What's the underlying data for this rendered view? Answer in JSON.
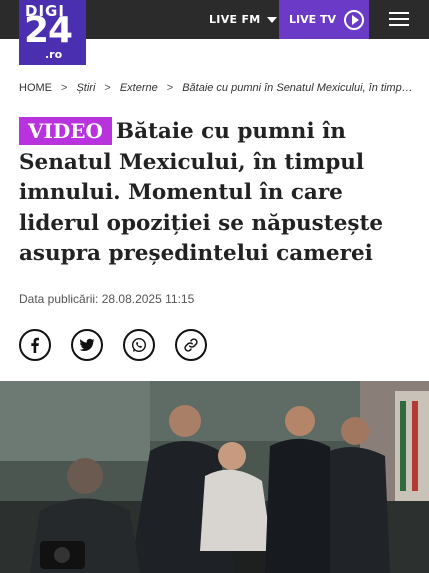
{
  "header": {
    "logo_top": "DIGI",
    "logo_main": "24",
    "logo_suffix": ".ro",
    "live_fm_label": "LIVE FM",
    "live_tv_label": "LIVE TV"
  },
  "breadcrumb": {
    "items": [
      "HOME",
      "Știri",
      "Externe"
    ],
    "separator": ">",
    "current": "Bătaie cu pumni în Senatul Mexicului, în timpul imnului. Momentul în care liderul opoziției se năpustește asupra președintelui camerei"
  },
  "article": {
    "badge": "VIDEO",
    "title": "Bătaie cu pumni în Senatul Mexicului, în timpul imnului. Momentul în care liderul opoziției se năpustește asupra președintelui camerei",
    "date_label": "Data publicării:",
    "date_value": "28.08.2025 11:15"
  },
  "share": {
    "icons": [
      "facebook-icon",
      "twitter-icon",
      "whatsapp-icon",
      "link-icon"
    ]
  },
  "colors": {
    "header_bg": "#2b2b2b",
    "logo_bg": "#4a2fb0",
    "live_tv_bg": "#6b3bc8",
    "badge_bg": "#b832dd"
  }
}
